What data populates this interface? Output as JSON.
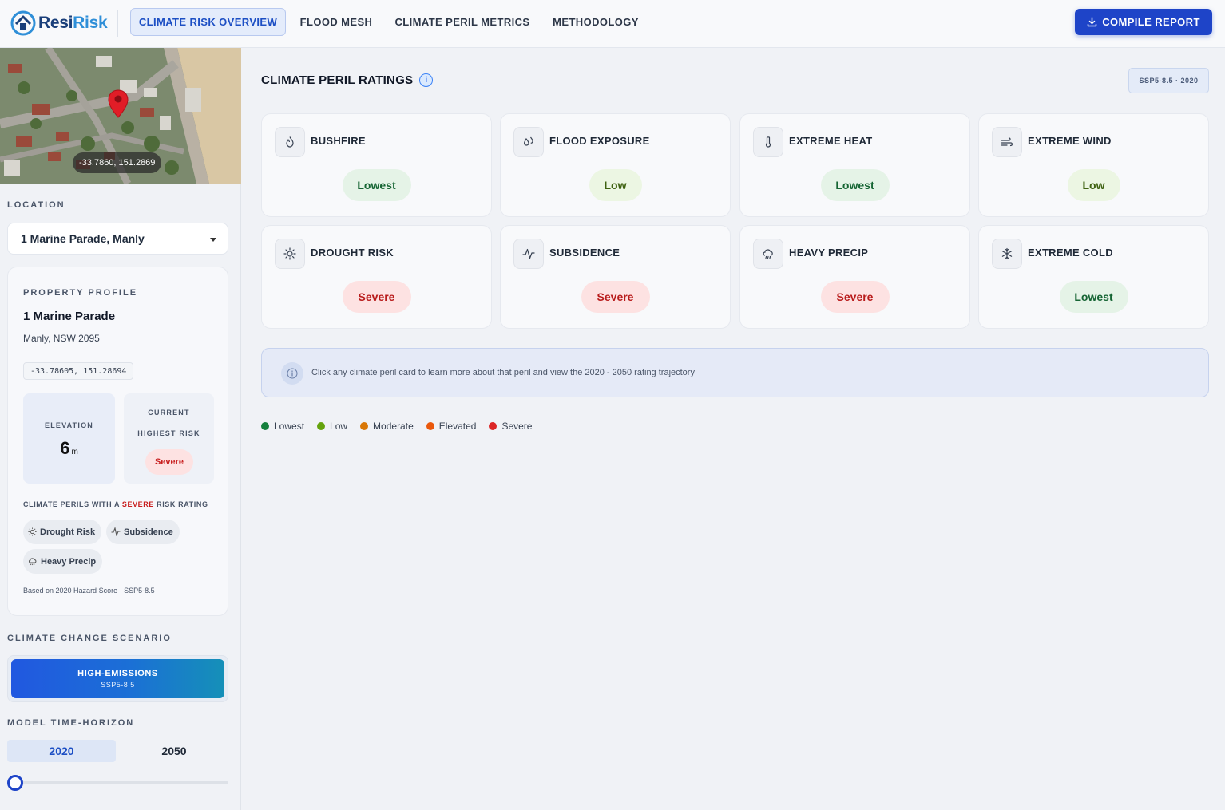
{
  "brand": {
    "part1": "Resi",
    "part2": "Risk"
  },
  "nav": {
    "tabs": [
      "CLIMATE RISK OVERVIEW",
      "FLOOD MESH",
      "CLIMATE PERIL METRICS",
      "METHODOLOGY"
    ],
    "active": "CLIMATE RISK OVERVIEW",
    "compile_label": "COMPILE REPORT"
  },
  "map": {
    "coordinates": "-33.7860, 151.2869"
  },
  "location": {
    "label": "LOCATION",
    "selected": "1 Marine Parade, Manly"
  },
  "profile": {
    "label": "PROPERTY PROFILE",
    "address": "1 Marine Parade",
    "suburb": "Manly, NSW 2095",
    "coords": "-33.78605, 151.28694",
    "elevation_label": "ELEVATION",
    "elevation_value": "6",
    "elevation_unit": "m",
    "current_label_1": "CURRENT",
    "current_label_2": "HIGHEST RISK",
    "current_value": "Severe",
    "perils_header_pre": "CLIMATE PERILS WITH A",
    "perils_header_sev": "SEVERE",
    "perils_header_post": "RISK RATING",
    "severe_perils": [
      "Drought Risk",
      "Subsidence",
      "Heavy Precip"
    ],
    "based_on": "Based on 2020 Hazard Score · SSP5-8.5"
  },
  "scenario": {
    "label": "CLIMATE CHANGE SCENARIO",
    "name": "HIGH-EMISSIONS",
    "code": "SSP5-8.5"
  },
  "horizon": {
    "label": "MODEL TIME-HORIZON",
    "years": [
      "2020",
      "2050"
    ],
    "selected": "2020",
    "slider_position": 0
  },
  "main": {
    "title": "CLIMATE PERIL RATINGS",
    "info_icon": "i",
    "scenario_badge": "SSP5-8.5 · 2020",
    "perils": [
      {
        "name": "BUSHFIRE",
        "rating": "Lowest",
        "icon": "flame-icon"
      },
      {
        "name": "FLOOD EXPOSURE",
        "rating": "Low",
        "icon": "droplets-icon"
      },
      {
        "name": "EXTREME HEAT",
        "rating": "Lowest",
        "icon": "thermometer-icon"
      },
      {
        "name": "EXTREME WIND",
        "rating": "Low",
        "icon": "wind-icon"
      },
      {
        "name": "DROUGHT RISK",
        "rating": "Severe",
        "icon": "sun-icon"
      },
      {
        "name": "SUBSIDENCE",
        "rating": "Severe",
        "icon": "activity-icon"
      },
      {
        "name": "HEAVY PRECIP",
        "rating": "Severe",
        "icon": "cloud-rain-icon"
      },
      {
        "name": "EXTREME COLD",
        "rating": "Lowest",
        "icon": "snowflake-icon"
      }
    ],
    "info_text": "Click any climate peril card to learn more about that peril and view the 2020 - 2050 rating trajectory",
    "legend": [
      {
        "label": "Lowest",
        "color": "#15803d"
      },
      {
        "label": "Low",
        "color": "#65a30d"
      },
      {
        "label": "Moderate",
        "color": "#d97706"
      },
      {
        "label": "Elevated",
        "color": "#ea580c"
      },
      {
        "label": "Severe",
        "color": "#dc2626"
      }
    ]
  }
}
